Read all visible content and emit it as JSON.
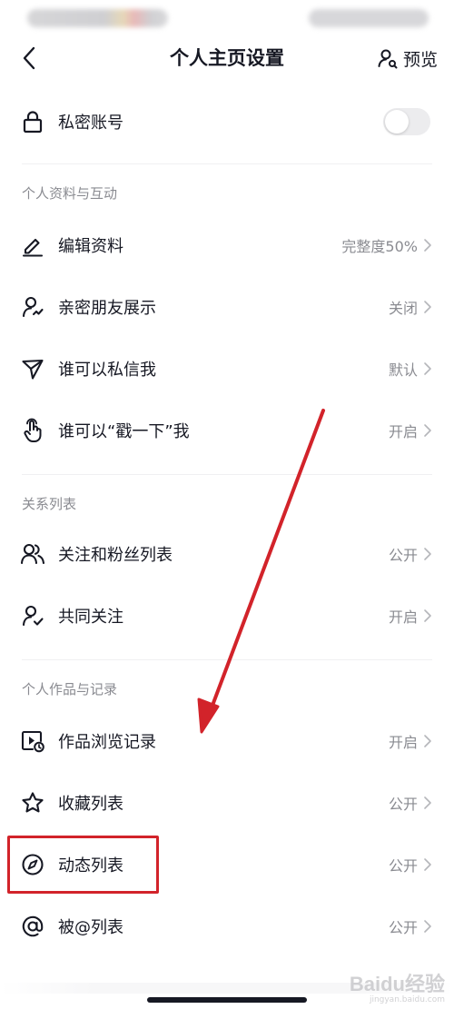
{
  "nav": {
    "title": "个人主页设置",
    "preview_label": "预览"
  },
  "privacy": {
    "label": "私密账号",
    "toggle_on": false
  },
  "sections": [
    {
      "header": "个人资料与互动",
      "items": [
        {
          "label": "编辑资料",
          "value": "完整度50%",
          "icon": "edit-icon"
        },
        {
          "label": "亲密朋友展示",
          "value": "关闭",
          "icon": "close-friend-icon"
        },
        {
          "label": "谁可以私信我",
          "value": "默认",
          "icon": "send-icon"
        },
        {
          "label": "谁可以“戳一下”我",
          "value": "开启",
          "icon": "tap-hand-icon"
        }
      ]
    },
    {
      "header": "关系列表",
      "items": [
        {
          "label": "关注和粉丝列表",
          "value": "公开",
          "icon": "users-icon"
        },
        {
          "label": "共同关注",
          "value": "开启",
          "icon": "user-check-icon"
        }
      ]
    },
    {
      "header": "个人作品与记录",
      "items": [
        {
          "label": "作品浏览记录",
          "value": "开启",
          "icon": "video-history-icon"
        },
        {
          "label": "收藏列表",
          "value": "公开",
          "icon": "star-icon"
        },
        {
          "label": "动态列表",
          "value": "公开",
          "icon": "compass-icon"
        },
        {
          "label": "被@列表",
          "value": "公开",
          "icon": "at-icon"
        }
      ]
    }
  ],
  "watermark": {
    "text": "Baidu经验",
    "sub": "jingyan.baidu.com"
  },
  "colors": {
    "text_primary": "#161823",
    "text_secondary": "#8a8b91",
    "annotation_red": "#d2232a",
    "toggle_off": "#ececee"
  }
}
